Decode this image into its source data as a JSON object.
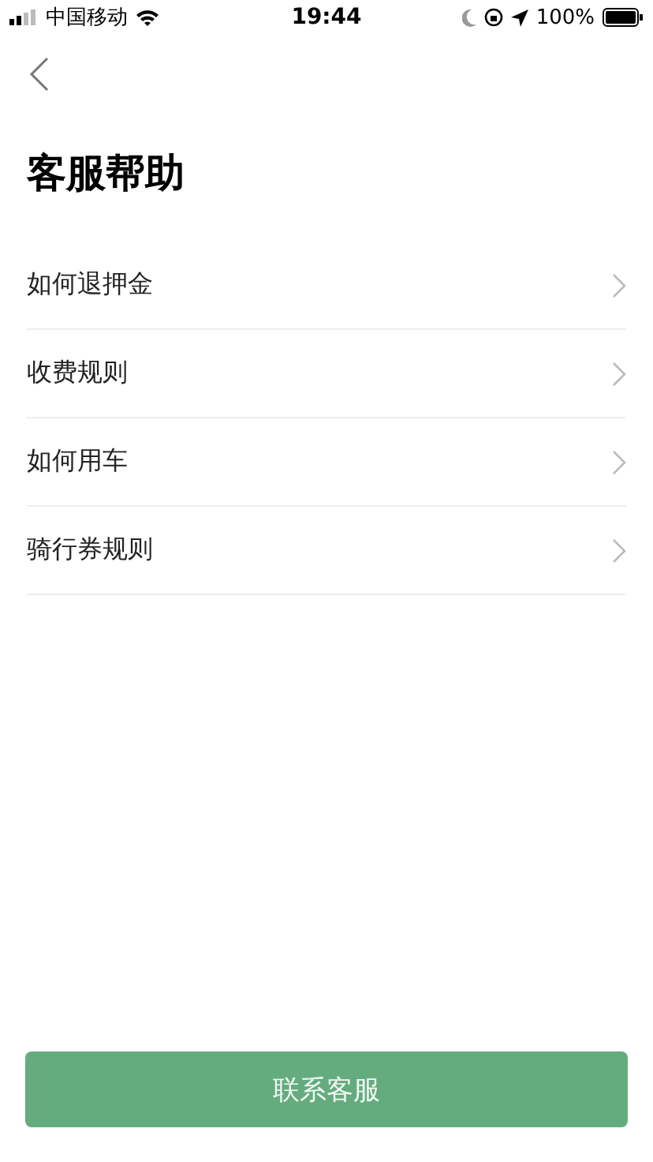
{
  "status_bar": {
    "carrier": "中国移动",
    "time": "19:44",
    "battery": "100%"
  },
  "title": "客服帮助",
  "items": [
    {
      "label": "如何退押金"
    },
    {
      "label": "收费规则"
    },
    {
      "label": "如何用车"
    },
    {
      "label": "骑行券规则"
    }
  ],
  "contact_button": "联系客服"
}
